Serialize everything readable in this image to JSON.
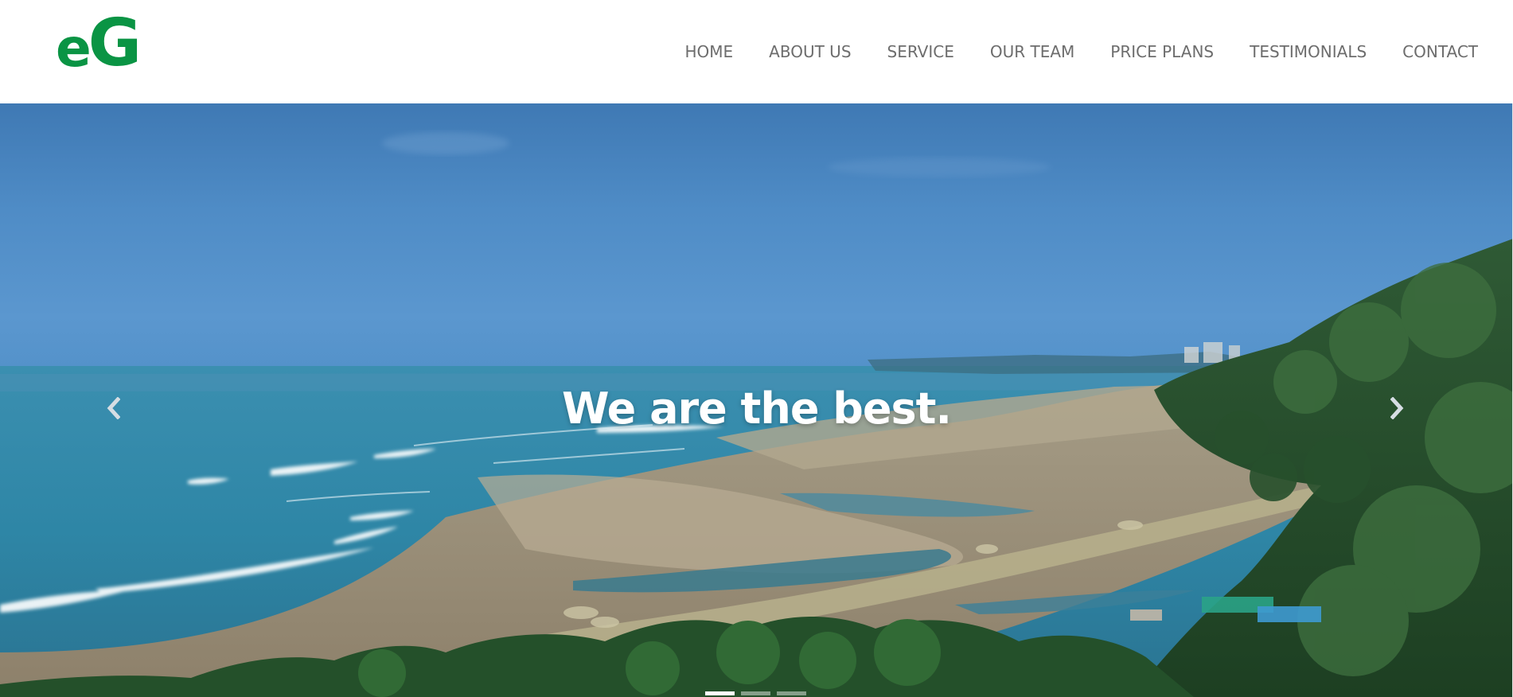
{
  "header": {
    "logo": {
      "part1": "e",
      "part2": "G",
      "color": "#0a9444"
    },
    "nav": [
      {
        "label": "HOME"
      },
      {
        "label": "ABOUT US"
      },
      {
        "label": "SERVICE"
      },
      {
        "label": "OUR TEAM"
      },
      {
        "label": "PRICE PLANS"
      },
      {
        "label": "TESTIMONIALS"
      },
      {
        "label": "CONTACT"
      }
    ]
  },
  "hero": {
    "caption": "We are the best.",
    "prev_icon": "chevron-left-icon",
    "next_icon": "chevron-right-icon",
    "slide_count": 3,
    "active_slide": 1
  }
}
